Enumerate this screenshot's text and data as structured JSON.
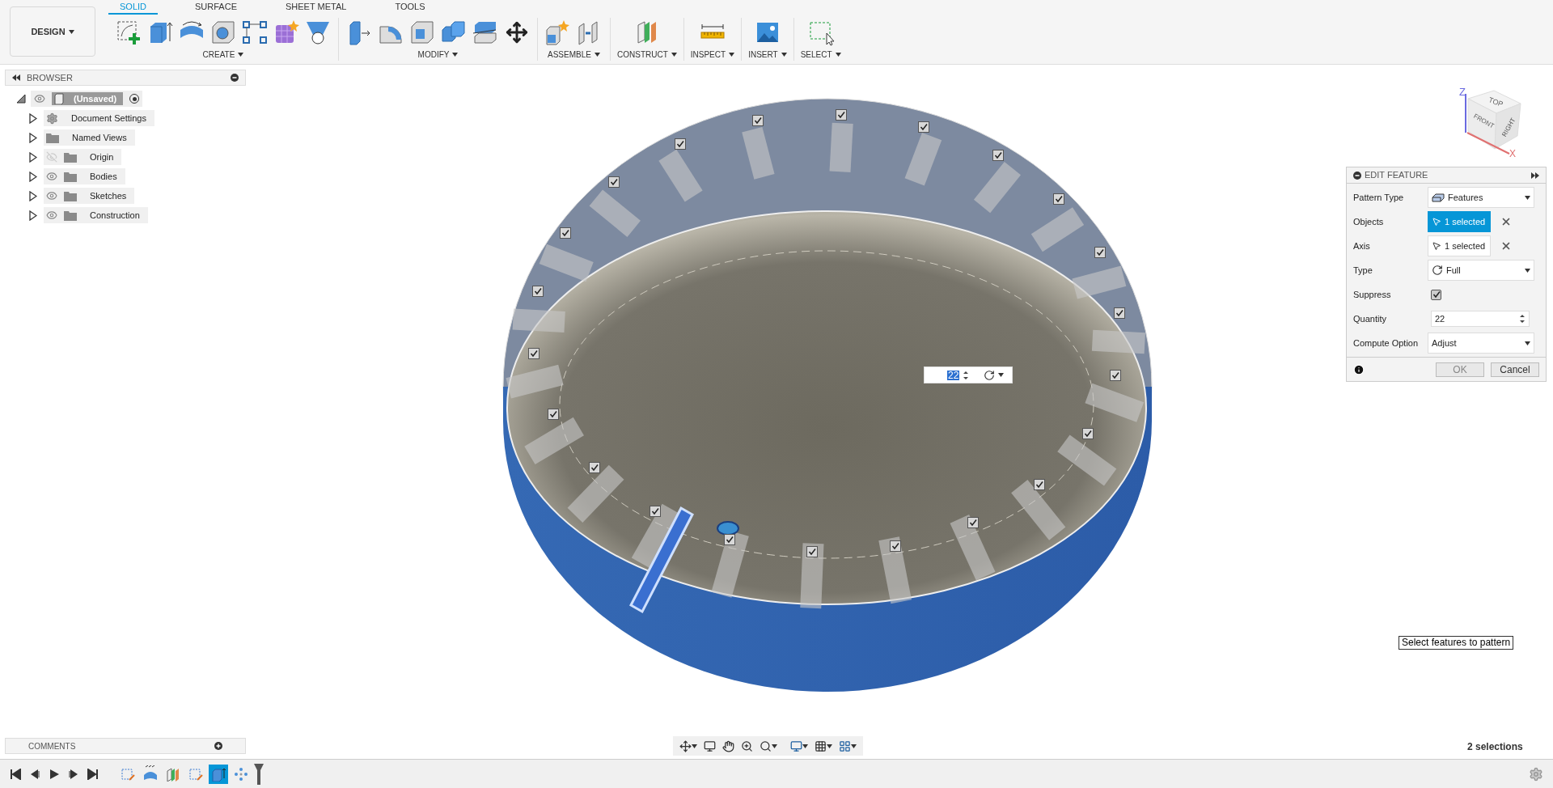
{
  "toolbar": {
    "workspace": "DESIGN",
    "tabs": [
      {
        "label": "SOLID",
        "selected": true
      },
      {
        "label": "SURFACE",
        "selected": false
      },
      {
        "label": "SHEET METAL",
        "selected": false
      },
      {
        "label": "TOOLS",
        "selected": false
      }
    ],
    "groups": [
      {
        "label": "CREATE"
      },
      {
        "label": "MODIFY"
      },
      {
        "label": "ASSEMBLE"
      },
      {
        "label": "CONSTRUCT"
      },
      {
        "label": "INSPECT"
      },
      {
        "label": "INSERT"
      },
      {
        "label": "SELECT"
      }
    ]
  },
  "browser": {
    "title": "BROWSER",
    "root": {
      "label": "(Unsaved)",
      "active": true
    },
    "items": [
      {
        "label": "Document Settings",
        "kind": "settings"
      },
      {
        "label": "Named Views",
        "kind": "folder"
      },
      {
        "label": "Origin",
        "kind": "folder",
        "visible": false
      },
      {
        "label": "Bodies",
        "kind": "folder",
        "visible": true
      },
      {
        "label": "Sketches",
        "kind": "folder",
        "visible": true
      },
      {
        "label": "Construction",
        "kind": "folder",
        "visible": true
      }
    ]
  },
  "viewcube": {
    "top": "TOP",
    "front": "FRONT",
    "right": "RIGHT",
    "z_axis": "Z",
    "x_axis": "X"
  },
  "edit_feature": {
    "title": "EDIT FEATURE",
    "rows": [
      {
        "label": "Pattern Type",
        "kind": "dropdown",
        "value": "Features"
      },
      {
        "label": "Objects",
        "kind": "selection",
        "value": "1 selected",
        "active": true
      },
      {
        "label": "Axis",
        "kind": "selection",
        "value": "1 selected",
        "active": false
      },
      {
        "label": "Type",
        "kind": "dropdown",
        "value": "Full"
      },
      {
        "label": "Suppress",
        "kind": "checkbox",
        "checked": true
      },
      {
        "label": "Quantity",
        "kind": "number",
        "value": "22"
      },
      {
        "label": "Compute Option",
        "kind": "dropdown",
        "value": "Adjust"
      }
    ],
    "buttons": [
      {
        "label": "OK",
        "disabled": true
      },
      {
        "label": "Cancel",
        "disabled": false
      }
    ]
  },
  "viewport": {
    "quantity_input": {
      "value": "22"
    },
    "pattern_instances": [
      {
        "checked": true
      },
      {
        "checked": true
      },
      {
        "checked": true
      },
      {
        "checked": true
      },
      {
        "checked": true
      },
      {
        "checked": true
      },
      {
        "checked": true
      },
      {
        "checked": true
      },
      {
        "checked": true
      },
      {
        "checked": true
      },
      {
        "checked": true
      },
      {
        "checked": true
      },
      {
        "checked": true
      },
      {
        "checked": true
      },
      {
        "checked": true
      },
      {
        "checked": true
      },
      {
        "checked": true
      },
      {
        "checked": true
      },
      {
        "checked": true
      },
      {
        "checked": true
      },
      {
        "checked": true
      },
      {
        "checked": true
      }
    ],
    "tooltip": "Select features to pattern",
    "selection_count": "2 selections"
  },
  "comments": {
    "title": "COMMENTS"
  },
  "timeline": {
    "features": [
      {
        "kind": "sketch",
        "selected": false
      },
      {
        "kind": "form",
        "selected": false
      },
      {
        "kind": "plane",
        "selected": false
      },
      {
        "kind": "sketch",
        "selected": false
      },
      {
        "kind": "extrude",
        "selected": true
      },
      {
        "kind": "pattern",
        "selected": false
      }
    ]
  }
}
